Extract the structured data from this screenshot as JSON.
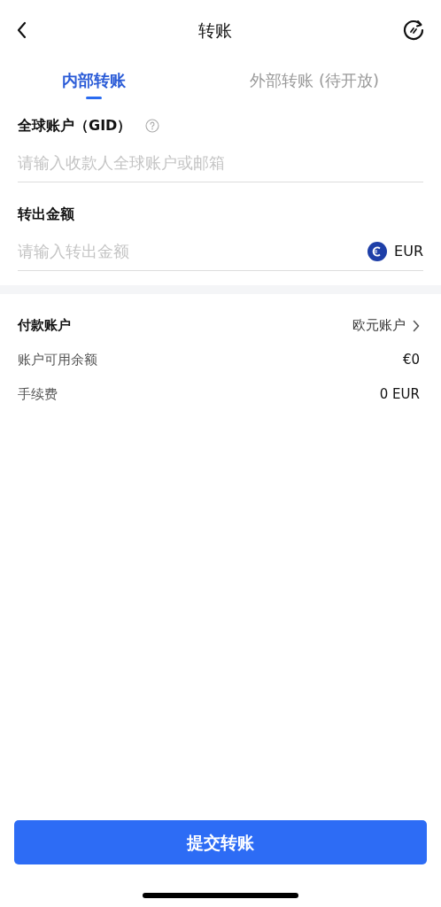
{
  "header": {
    "title": "转账"
  },
  "tabs": [
    {
      "label": "内部转账",
      "selected": true
    },
    {
      "label": "外部转账 (待开放)",
      "selected": false
    }
  ],
  "fields": [
    {
      "kind": "help",
      "label": "全球账户（GID）",
      "placeholder": "请输入收款人全球账户或邮箱"
    },
    {
      "kind": "currency",
      "label": "转出金额",
      "placeholder": "请输入转出金额",
      "currency": "EUR"
    }
  ],
  "details": [
    {
      "kind": "link",
      "label": "付款账户",
      "value": "欧元账户"
    },
    {
      "kind": "plain",
      "label": "账户可用余额",
      "value": "€0"
    },
    {
      "kind": "plain",
      "label": "手续费",
      "value": "0 EUR"
    }
  ],
  "submit": {
    "label": "提交转账"
  }
}
